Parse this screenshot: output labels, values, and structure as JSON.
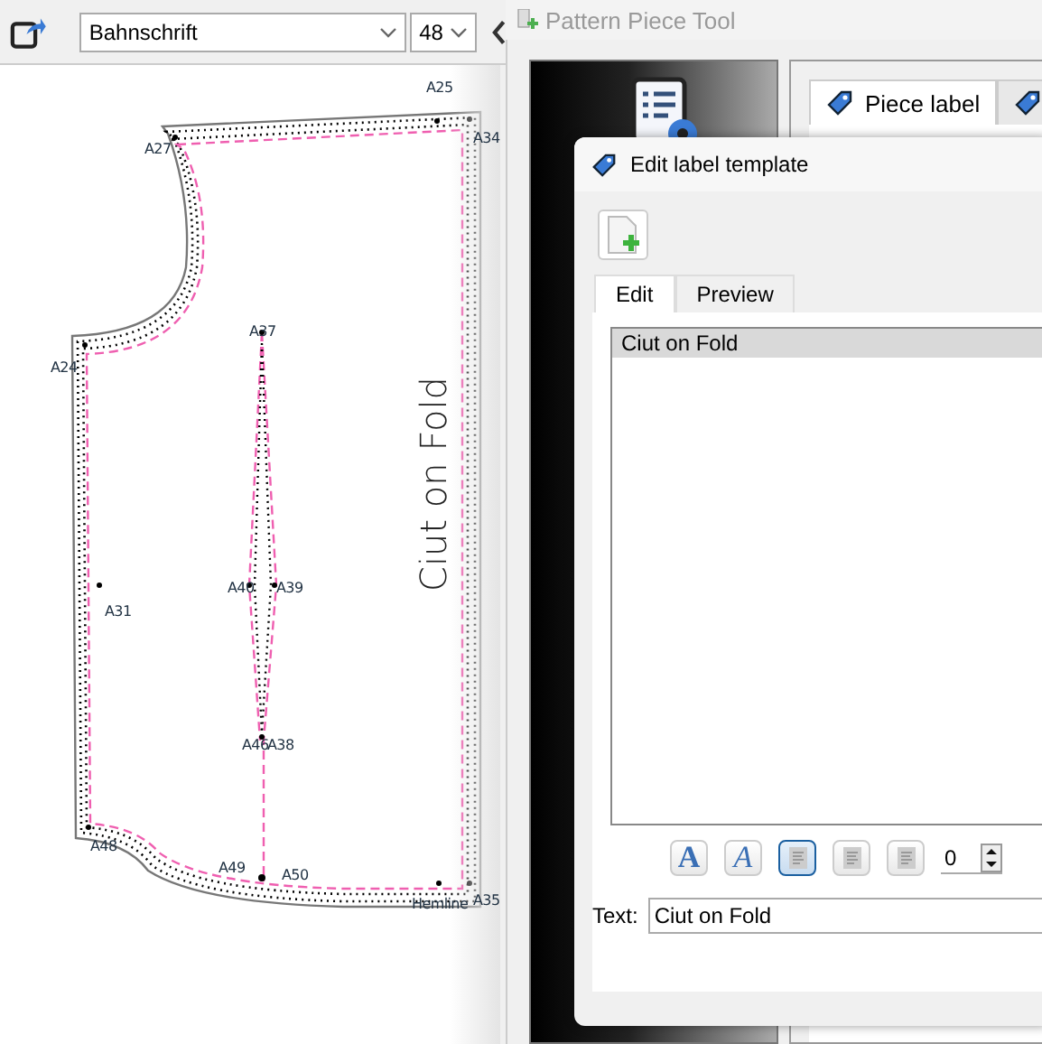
{
  "toolbar": {
    "font": "Bahnschrift",
    "size": "48"
  },
  "pattern": {
    "point_labels": [
      "A25",
      "A34",
      "A27",
      "A24",
      "A37",
      "A40",
      "A39",
      "A31",
      "A46",
      "A38",
      "A48",
      "A49",
      "A50",
      "Hemline",
      "A35"
    ],
    "fold_label": "Ciut on Fold"
  },
  "main_window": {
    "title": "Pattern Piece Tool",
    "tabs": [
      {
        "label": "Piece label",
        "selected": true
      },
      {
        "selected": false
      }
    ]
  },
  "dialog": {
    "title": "Edit label template",
    "tabs": [
      {
        "label": "Edit",
        "selected": true
      },
      {
        "label": "Preview",
        "selected": false
      }
    ],
    "lines": [
      {
        "text": "Ciut on Fold",
        "selected": true
      }
    ],
    "format_buttons": [
      {
        "kind": "bold",
        "glyph": "A",
        "selected": false
      },
      {
        "kind": "italic",
        "glyph": "A",
        "selected": false
      },
      {
        "kind": "align-left",
        "selected": true
      },
      {
        "kind": "align-center",
        "selected": false
      },
      {
        "kind": "align-right",
        "selected": false
      }
    ],
    "spin_value": "0",
    "text_label": "Text:",
    "text_value": "Ciut on Fold"
  }
}
